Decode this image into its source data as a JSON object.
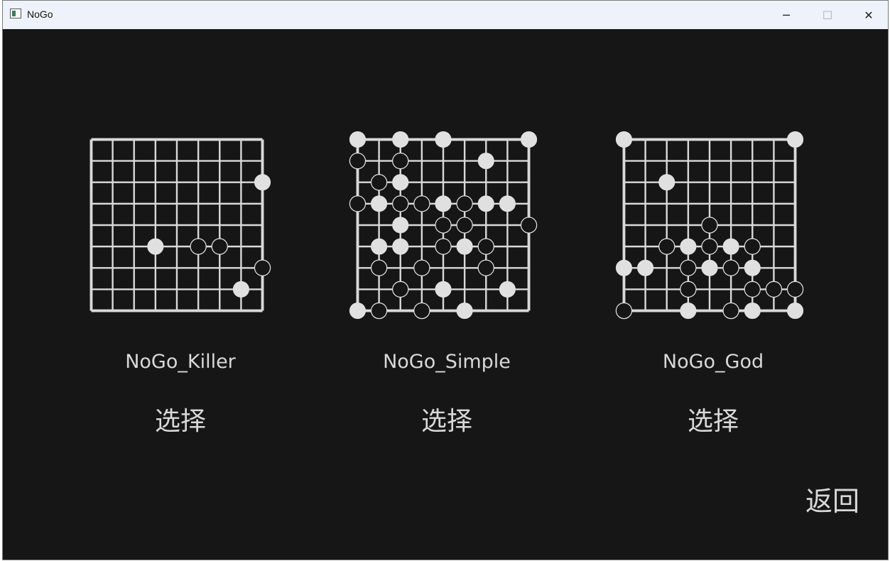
{
  "window": {
    "title": "NoGo",
    "minimize_icon": "─",
    "maximize_icon": "☐",
    "close_icon": "✕"
  },
  "colors": {
    "background": "#161616",
    "board_line": "#d9d9d9",
    "white_stone": "#e0e0e0",
    "black_stone": "#161616",
    "text": "#d8d8d8"
  },
  "board_size": 9,
  "ais": [
    {
      "name": "NoGo_Killer",
      "select_label": "选择",
      "stones": [
        {
          "col": 8,
          "row": 2,
          "color": "white"
        },
        {
          "col": 3,
          "row": 5,
          "color": "white"
        },
        {
          "col": 5,
          "row": 5,
          "color": "black"
        },
        {
          "col": 6,
          "row": 5,
          "color": "black"
        },
        {
          "col": 8,
          "row": 6,
          "color": "black"
        },
        {
          "col": 7,
          "row": 7,
          "color": "white"
        }
      ]
    },
    {
      "name": "NoGo_Simple",
      "select_label": "选择",
      "stones": [
        {
          "col": 0,
          "row": 0,
          "color": "white"
        },
        {
          "col": 2,
          "row": 0,
          "color": "white"
        },
        {
          "col": 4,
          "row": 0,
          "color": "white"
        },
        {
          "col": 8,
          "row": 0,
          "color": "white"
        },
        {
          "col": 0,
          "row": 1,
          "color": "black"
        },
        {
          "col": 2,
          "row": 1,
          "color": "black"
        },
        {
          "col": 6,
          "row": 1,
          "color": "white"
        },
        {
          "col": 1,
          "row": 2,
          "color": "black"
        },
        {
          "col": 2,
          "row": 2,
          "color": "white"
        },
        {
          "col": 0,
          "row": 3,
          "color": "black"
        },
        {
          "col": 1,
          "row": 3,
          "color": "white"
        },
        {
          "col": 2,
          "row": 3,
          "color": "black"
        },
        {
          "col": 3,
          "row": 3,
          "color": "black"
        },
        {
          "col": 4,
          "row": 3,
          "color": "white"
        },
        {
          "col": 5,
          "row": 3,
          "color": "black"
        },
        {
          "col": 6,
          "row": 3,
          "color": "white"
        },
        {
          "col": 7,
          "row": 3,
          "color": "white"
        },
        {
          "col": 2,
          "row": 4,
          "color": "white"
        },
        {
          "col": 4,
          "row": 4,
          "color": "black"
        },
        {
          "col": 5,
          "row": 4,
          "color": "black"
        },
        {
          "col": 8,
          "row": 4,
          "color": "black"
        },
        {
          "col": 1,
          "row": 5,
          "color": "white"
        },
        {
          "col": 2,
          "row": 5,
          "color": "white"
        },
        {
          "col": 4,
          "row": 5,
          "color": "black"
        },
        {
          "col": 5,
          "row": 5,
          "color": "white"
        },
        {
          "col": 6,
          "row": 5,
          "color": "black"
        },
        {
          "col": 1,
          "row": 6,
          "color": "black"
        },
        {
          "col": 3,
          "row": 6,
          "color": "black"
        },
        {
          "col": 6,
          "row": 6,
          "color": "black"
        },
        {
          "col": 2,
          "row": 7,
          "color": "black"
        },
        {
          "col": 4,
          "row": 7,
          "color": "white"
        },
        {
          "col": 7,
          "row": 7,
          "color": "white"
        },
        {
          "col": 0,
          "row": 8,
          "color": "white"
        },
        {
          "col": 1,
          "row": 8,
          "color": "black"
        },
        {
          "col": 3,
          "row": 8,
          "color": "black"
        },
        {
          "col": 5,
          "row": 8,
          "color": "white"
        }
      ]
    },
    {
      "name": "NoGo_God",
      "select_label": "选择",
      "stones": [
        {
          "col": 0,
          "row": 0,
          "color": "white"
        },
        {
          "col": 8,
          "row": 0,
          "color": "white"
        },
        {
          "col": 2,
          "row": 2,
          "color": "white"
        },
        {
          "col": 4,
          "row": 4,
          "color": "black"
        },
        {
          "col": 2,
          "row": 5,
          "color": "black"
        },
        {
          "col": 3,
          "row": 5,
          "color": "white"
        },
        {
          "col": 4,
          "row": 5,
          "color": "black"
        },
        {
          "col": 5,
          "row": 5,
          "color": "white"
        },
        {
          "col": 6,
          "row": 5,
          "color": "black"
        },
        {
          "col": 0,
          "row": 6,
          "color": "white"
        },
        {
          "col": 1,
          "row": 6,
          "color": "white"
        },
        {
          "col": 3,
          "row": 6,
          "color": "black"
        },
        {
          "col": 4,
          "row": 6,
          "color": "white"
        },
        {
          "col": 5,
          "row": 6,
          "color": "black"
        },
        {
          "col": 6,
          "row": 6,
          "color": "white"
        },
        {
          "col": 3,
          "row": 7,
          "color": "black"
        },
        {
          "col": 6,
          "row": 7,
          "color": "black"
        },
        {
          "col": 7,
          "row": 7,
          "color": "black"
        },
        {
          "col": 8,
          "row": 7,
          "color": "black"
        },
        {
          "col": 0,
          "row": 8,
          "color": "black"
        },
        {
          "col": 3,
          "row": 8,
          "color": "white"
        },
        {
          "col": 5,
          "row": 8,
          "color": "black"
        },
        {
          "col": 6,
          "row": 8,
          "color": "white"
        },
        {
          "col": 8,
          "row": 8,
          "color": "white"
        }
      ]
    }
  ],
  "back_label": "返回"
}
